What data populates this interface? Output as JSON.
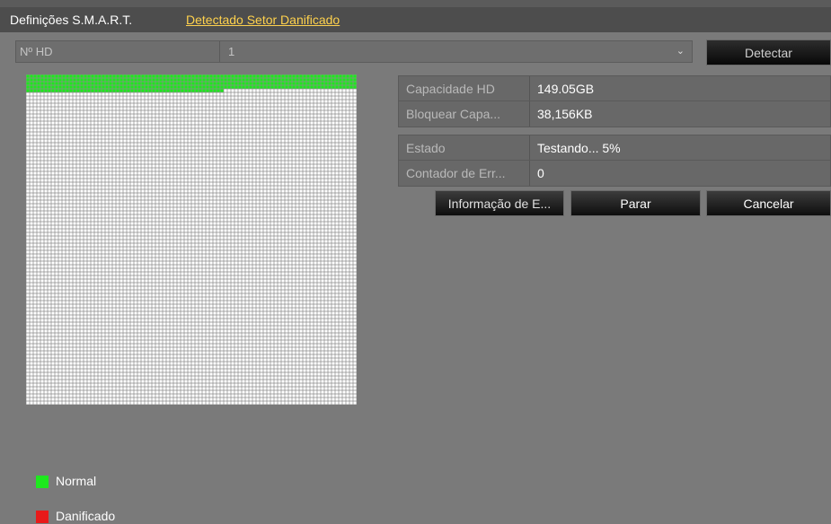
{
  "tabs": [
    "Definições S.M.A.R.T.",
    "Detectado Setor Danificado"
  ],
  "hd": {
    "label": "Nº HD",
    "value": "1",
    "detect_button": "Detectar"
  },
  "info": [
    {
      "label": "Capacidade HD",
      "value": "149.05GB"
    },
    {
      "label": "Bloquear Capa...",
      "value": "38,156KB"
    },
    {
      "label": "Estado",
      "value": "Testando... 5%"
    },
    {
      "label": "Contador de Err...",
      "value": "0"
    }
  ],
  "buttons": {
    "error_info": "Informação de E...",
    "stop": "Parar",
    "cancel": "Cancelar"
  },
  "legend": [
    {
      "label": "Normal",
      "color": "#1ee81e"
    },
    {
      "label": "Danificado",
      "color": "#e81a1a"
    }
  ],
  "scan": {
    "progress_percent": 5,
    "normal_color": "#1ee81e",
    "pending_color": "#ffffff",
    "grid_line_color": "#8c8c8c"
  }
}
